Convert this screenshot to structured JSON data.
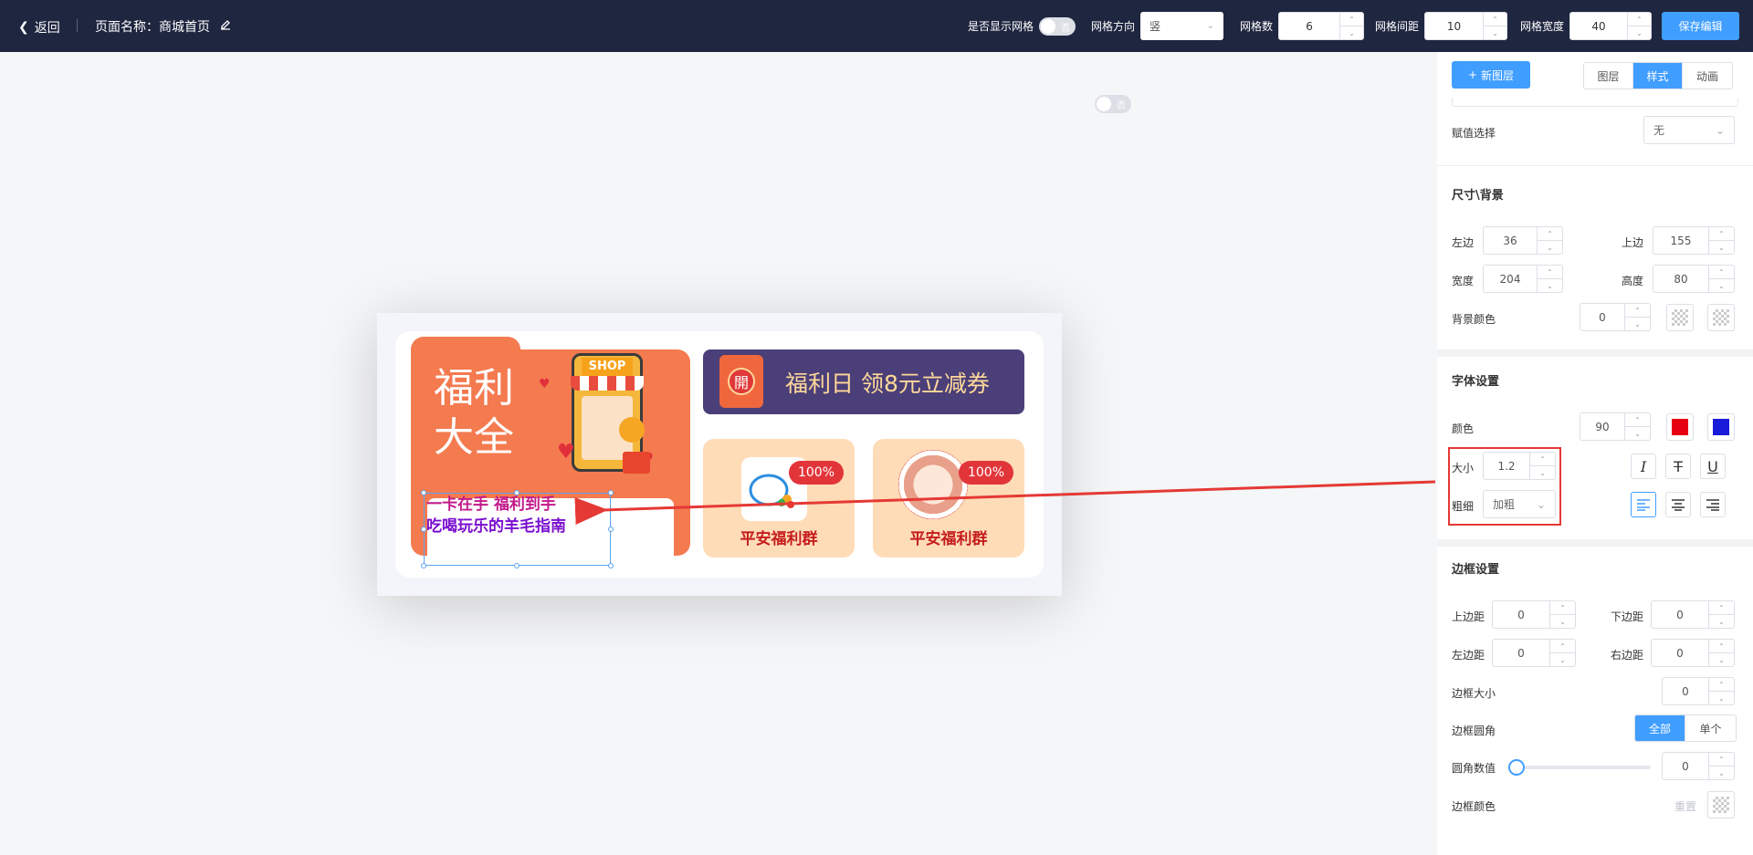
{
  "header": {
    "back_label": "返回",
    "page_name_label": "页面名称：商城首页",
    "grid_show_label": "是否显示网格",
    "grid_toggle_text": "否",
    "grid_dir_label": "网格方向",
    "grid_dir_value": "竖",
    "grid_count_label": "网格数",
    "grid_count_value": "6",
    "grid_gap_label": "网格间距",
    "grid_gap_value": "10",
    "grid_width_label": "网格宽度",
    "grid_width_value": "40",
    "save_label": "保存编辑"
  },
  "canvas": {
    "toggle_text": "否",
    "fuli_line1": "福利",
    "fuli_line2": "大全",
    "shop_label": "SHOP",
    "selected_text_line1": "一卡在手 福利到手",
    "selected_text_line2": "吃喝玩乐的羊毛指南",
    "banner_icon_text": "開",
    "banner_text": "福利日 领8元立减券",
    "group1_badge": "100%",
    "group1_title": "平安福利群",
    "group2_badge": "100%",
    "group2_title": "平安福利群"
  },
  "panel": {
    "new_layer_label": "新图层",
    "tabs": [
      "图层",
      "样式",
      "动画"
    ],
    "active_tab": "样式",
    "assign_label": "赋值选择",
    "assign_value": "无",
    "size_title": "尺寸\\背景",
    "left_label": "左边",
    "left_value": "36",
    "top_label": "上边",
    "top_value": "155",
    "width_label": "宽度",
    "width_value": "204",
    "height_label": "高度",
    "height_value": "80",
    "bg_label": "背景颜色",
    "bg_value": "0",
    "font_title": "字体设置",
    "color_label": "颜色",
    "color_value": "90",
    "color_swatch_1": "#e60012",
    "color_swatch_2": "#1a1adb",
    "size_label": "大小",
    "size_value": "1.2",
    "weight_label": "粗细",
    "weight_value": "加粗",
    "border_title": "边框设置",
    "pad_top_label": "上边距",
    "pad_top_value": "0",
    "pad_bottom_label": "下边距",
    "pad_bottom_value": "0",
    "pad_left_label": "左边距",
    "pad_left_value": "0",
    "pad_right_label": "右边距",
    "pad_right_value": "0",
    "border_size_label": "边框大小",
    "border_size_value": "0",
    "radius_label": "边框圆角",
    "radius_all": "全部",
    "radius_single": "单个",
    "radius_value_label": "圆角数值",
    "radius_value": "0",
    "border_color_label": "边框颜色",
    "reset_label": "重置"
  },
  "colors": {
    "accent": "#409eff",
    "header_bg": "#1f2640",
    "annotation": "#e53935"
  }
}
